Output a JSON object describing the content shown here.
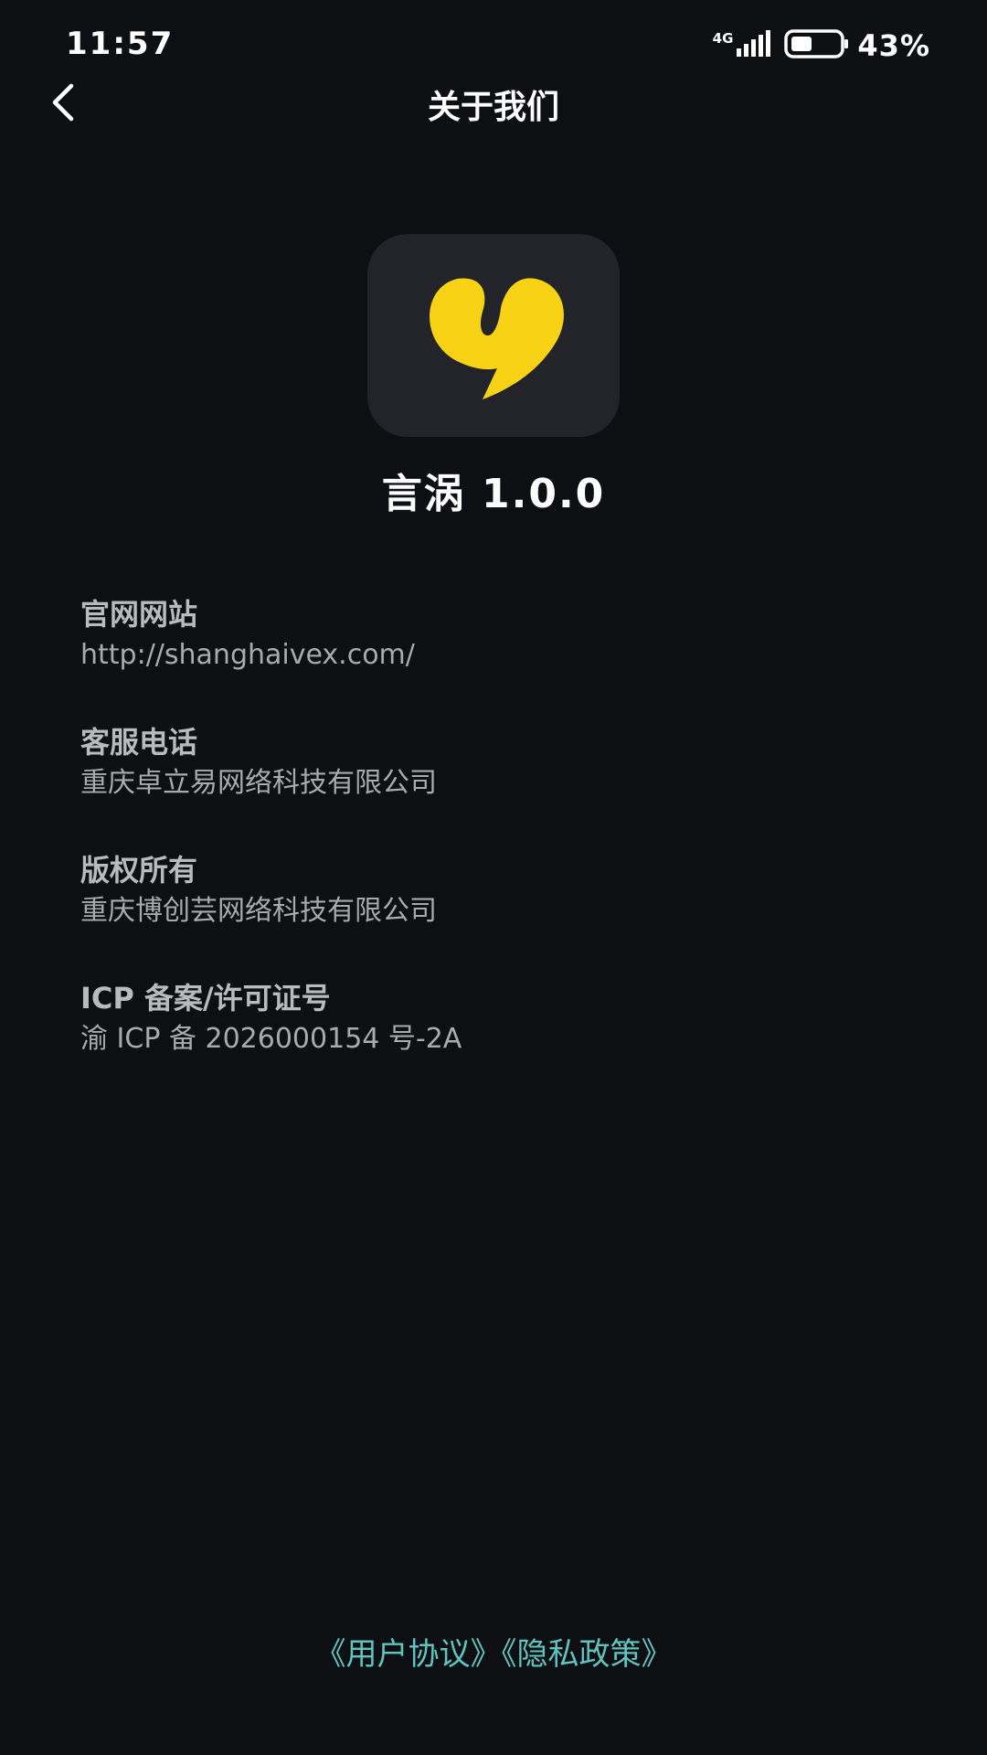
{
  "status_bar": {
    "time": "11:57",
    "network": "4G",
    "battery_percent": "43%",
    "battery_level": 0.43
  },
  "header": {
    "back_icon": "chevron-left-icon",
    "title": "关于我们"
  },
  "app": {
    "logo_icon": "yellow-speech-bubble-logo",
    "name_version": "言涡 1.0.0",
    "logo_color": "#f7d215"
  },
  "info": [
    {
      "label": "官网网站",
      "value": "http://shanghaivex.com/"
    },
    {
      "label": "客服电话",
      "value": "重庆卓立易网络科技有限公司"
    },
    {
      "label": "版权所有",
      "value": "重庆博创芸网络科技有限公司"
    },
    {
      "label": "ICP 备案/许可证号",
      "value": "渝 ICP 备 2026000154 号-2A"
    }
  ],
  "footer": {
    "user_agreement": "《用户协议》",
    "privacy_policy": "《隐私政策》",
    "link_color": "#5fc3c0"
  }
}
